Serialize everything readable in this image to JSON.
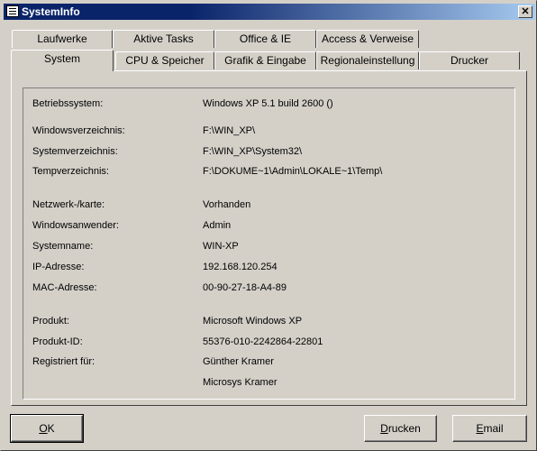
{
  "window": {
    "title": "SystemInfo",
    "close_glyph": "✕"
  },
  "tabs_back": [
    "Laufwerke",
    "Aktive Tasks",
    "Office & IE",
    "Access & Verweise"
  ],
  "tabs_front": [
    "System",
    "CPU & Speicher",
    "Grafik & Eingabe",
    "Regionaleinstellung",
    "Drucker"
  ],
  "active_tab": "System",
  "info": [
    {
      "label": "Betriebssystem:",
      "value": "Windows XP 5.1 build 2600 ()"
    },
    {
      "label": "Windowsverzeichnis:",
      "value": "F:\\WIN_XP\\"
    },
    {
      "label": "Systemverzeichnis:",
      "value": "F:\\WIN_XP\\System32\\"
    },
    {
      "label": "Tempverzeichnis:",
      "value": "F:\\DOKUME~1\\Admin\\LOKALE~1\\Temp\\"
    },
    {
      "label": "Netzwerk-/karte:",
      "value": "Vorhanden"
    },
    {
      "label": "Windowsanwender:",
      "value": "Admin"
    },
    {
      "label": "Systemname:",
      "value": "WIN-XP"
    },
    {
      "label": "IP-Adresse:",
      "value": "192.168.120.254"
    },
    {
      "label": "MAC-Adresse:",
      "value": "00-90-27-18-A4-89"
    },
    {
      "label": "Produkt:",
      "value": "Microsoft Windows XP"
    },
    {
      "label": "Produkt-ID:",
      "value": "55376-010-2242864-22801"
    },
    {
      "label": "Registriert für:",
      "value": "Günther Kramer"
    },
    {
      "label": "",
      "value": "Microsys Kramer"
    }
  ],
  "buttons": {
    "ok": {
      "first": "O",
      "rest": "K"
    },
    "print": {
      "first": "D",
      "rest": "rucken"
    },
    "email": {
      "first": "E",
      "rest": "mail"
    }
  }
}
